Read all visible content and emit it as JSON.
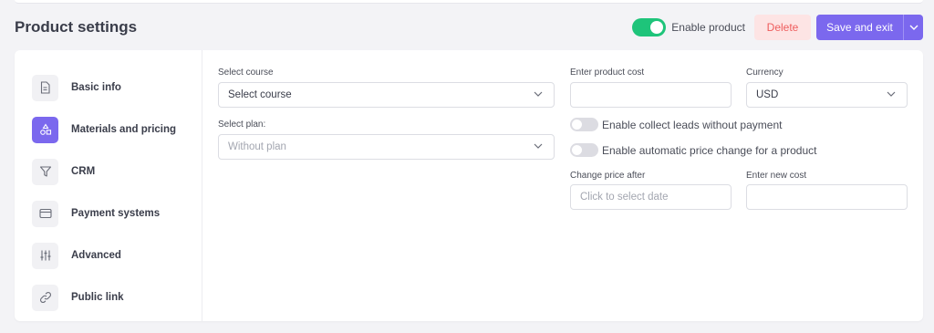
{
  "header": {
    "title": "Product settings",
    "enable_label": "Enable product",
    "enable_on": true,
    "delete_label": "Delete",
    "save_label": "Save and exit"
  },
  "sidebar": {
    "items": [
      {
        "label": "Basic info",
        "icon": "document-icon"
      },
      {
        "label": "Materials and pricing",
        "icon": "shapes-icon",
        "active": true
      },
      {
        "label": "CRM",
        "icon": "funnel-icon"
      },
      {
        "label": "Payment systems",
        "icon": "credit-card-icon"
      },
      {
        "label": "Advanced",
        "icon": "sliders-icon"
      },
      {
        "label": "Public link",
        "icon": "link-icon"
      }
    ]
  },
  "form": {
    "course_label": "Select course",
    "course_value": "Select course",
    "plan_label": "Select plan:",
    "plan_placeholder": "Without plan",
    "cost_label": "Enter product cost",
    "cost_value": "",
    "currency_label": "Currency",
    "currency_value": "USD",
    "leads_toggle_label": "Enable collect leads without payment",
    "auto_price_toggle_label": "Enable automatic price change for a product",
    "change_after_label": "Change price after",
    "change_after_placeholder": "Click to select date",
    "new_cost_label": "Enter new cost",
    "new_cost_value": ""
  },
  "colors": {
    "accent": "#7b68ee",
    "toggle_on": "#1ec47a",
    "delete_bg": "#fde4e4",
    "delete_text": "#ee5d5d"
  }
}
